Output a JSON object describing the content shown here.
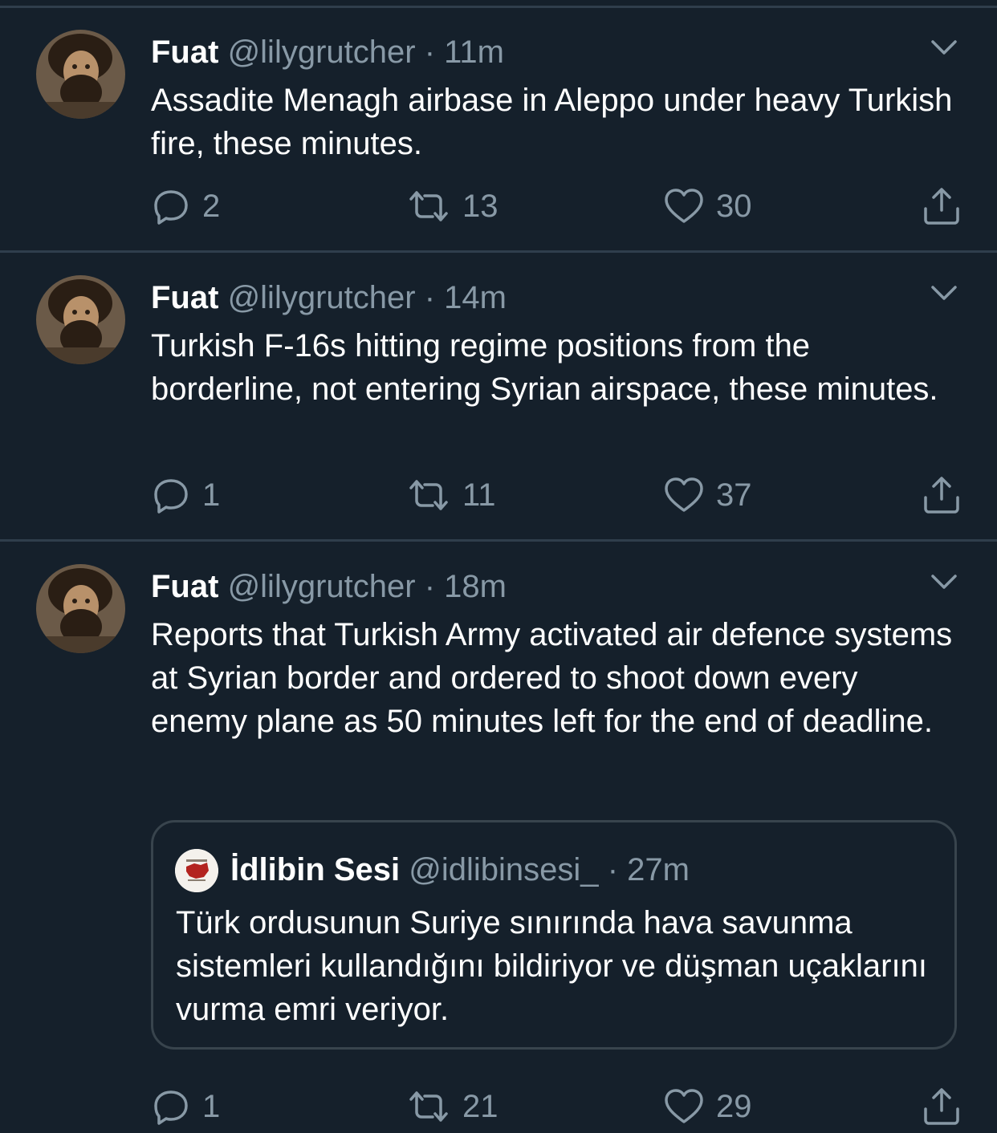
{
  "tweets": [
    {
      "name": "Fuat",
      "handle": "@lilygrutcher",
      "sep": "·",
      "time": "11m",
      "text": "Assadite Menagh airbase in Aleppo under heavy Turkish fire, these minutes.",
      "replies": "2",
      "retweets": "13",
      "likes": "30"
    },
    {
      "name": "Fuat",
      "handle": "@lilygrutcher",
      "sep": "·",
      "time": "14m",
      "text": "Turkish F-16s hitting regime positions from the borderline, not entering Syrian airspace, these minutes.",
      "replies": "1",
      "retweets": "11",
      "likes": "37"
    },
    {
      "name": "Fuat",
      "handle": "@lilygrutcher",
      "sep": "·",
      "time": "18m",
      "text": "Reports that Turkish Army activated air defence systems at Syrian border and ordered to shoot down every enemy plane as 50 minutes left for the end of deadline.",
      "replies": "1",
      "retweets": "21",
      "likes": "29",
      "quote": {
        "name": "İdlibin Sesi",
        "handle": "@idlibinsesi_",
        "sep": "·",
        "time": "27m",
        "text": "Türk ordusunun Suriye sınırında hava savunma sistemleri kullandığını bildiriyor ve düşman uçaklarını vurma emri veriyor."
      }
    }
  ],
  "icons": {
    "reply": "reply-icon",
    "retweet": "retweet-icon",
    "like": "heart-icon",
    "share": "share-icon",
    "more": "chevron-down-icon"
  },
  "colors": {
    "background": "#15202b",
    "secondary_text": "#8899a6",
    "divider": "#2f3e4c"
  }
}
